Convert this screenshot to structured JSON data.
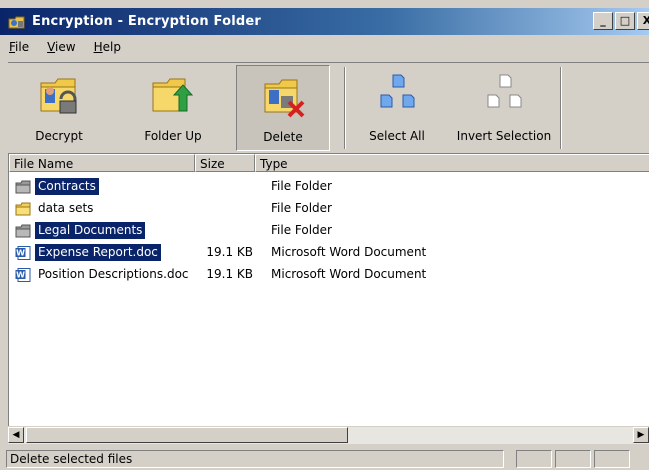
{
  "window": {
    "title": "Encryption - Encryption Folder",
    "buttons": [
      "_",
      "□",
      "X"
    ]
  },
  "menu": [
    "File",
    "View",
    "Help"
  ],
  "toolbar": [
    {
      "label": "Decrypt",
      "icon": "folder-lock-icon"
    },
    {
      "label": "Folder Up",
      "icon": "folder-up-arrow-icon"
    },
    {
      "label": "Delete",
      "icon": "folder-delete-icon"
    },
    {
      "label": "Select All",
      "icon": "select-all-icon"
    },
    {
      "label": "Invert Selection",
      "icon": "invert-selection-icon"
    }
  ],
  "columns": {
    "name": "File Name",
    "size": "Size",
    "type": "Type"
  },
  "files": [
    {
      "name": "Contracts",
      "size": "",
      "type": "File Folder",
      "kind": "folder-encrypted",
      "selected": true
    },
    {
      "name": "data sets",
      "size": "",
      "type": "File Folder",
      "kind": "folder",
      "selected": false
    },
    {
      "name": "Legal Documents",
      "size": "",
      "type": "File Folder",
      "kind": "folder-encrypted",
      "selected": true
    },
    {
      "name": "Expense Report.doc",
      "size": "19.1 KB",
      "type": "Microsoft Word Document",
      "kind": "word",
      "selected": true
    },
    {
      "name": "Position Descriptions.doc",
      "size": "19.1 KB",
      "type": "Microsoft Word Document",
      "kind": "word",
      "selected": false
    }
  ],
  "status": "Delete selected files"
}
